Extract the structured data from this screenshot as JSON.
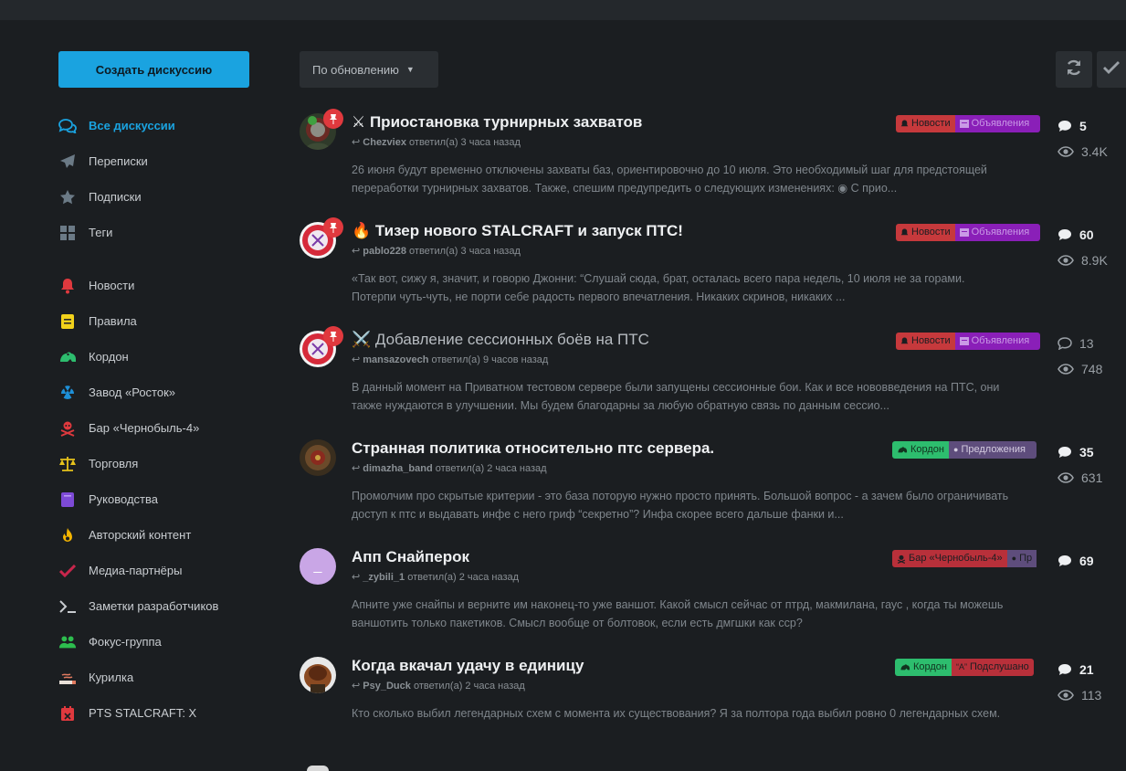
{
  "sidebar": {
    "create_label": "Создать дискуссию",
    "items": [
      {
        "label": "Все дискуссии",
        "icon": "comments-icon"
      },
      {
        "label": "Переписки",
        "icon": "paper-plane-icon"
      },
      {
        "label": "Подписки",
        "icon": "star-icon"
      },
      {
        "label": "Теги",
        "icon": "th-large-icon"
      },
      {
        "label": "Новости",
        "icon": "bell-icon"
      },
      {
        "label": "Правила",
        "icon": "rules-book-icon"
      },
      {
        "label": "Кордон",
        "icon": "frog-icon"
      },
      {
        "label": "Завод «Росток»",
        "icon": "radiation-icon"
      },
      {
        "label": "Бар «Чернобыль-4»",
        "icon": "skull-crossbones-icon"
      },
      {
        "label": "Торговля",
        "icon": "balance-scale-icon"
      },
      {
        "label": "Руководства",
        "icon": "book-icon"
      },
      {
        "label": "Авторский контент",
        "icon": "fire-icon"
      },
      {
        "label": "Медиа-партнёры",
        "icon": "check-icon"
      },
      {
        "label": "Заметки разработчиков",
        "icon": "terminal-icon"
      },
      {
        "label": "Фокус-группа",
        "icon": "users-icon"
      },
      {
        "label": "Курилка",
        "icon": "smoking-icon"
      },
      {
        "label": "PTS STALCRAFT: X",
        "icon": "calendar-x-icon"
      }
    ]
  },
  "toolbar": {
    "sort_label": "По обновлению",
    "refresh_icon": "refresh-icon",
    "mark_read_icon": "check-icon"
  },
  "discussions": [
    {
      "title": "⚔ Приостановка турнирных захватов",
      "author": "Chezviex",
      "action": "ответил(а) 3 часа назад",
      "excerpt": "26 июня будут временно отключены захваты баз, ориентировочно до 10 июля. Это необходимый шаг для предстоящей переработки турнирных захватов. Также, спешим предупредить о следующих изменениях: ◉ С прио...",
      "tags": [
        "Новости",
        "Объявления"
      ],
      "replies": "5",
      "views": "3.4K"
    },
    {
      "title": "🔥 Тизер нового STALCRAFT и запуск ПТС!",
      "author": "pablo228",
      "action": "ответил(а) 3 часа назад",
      "excerpt": "«Так вот, сижу я, значит, и говорю Джонни: “Слушай сюда, брат, осталась всего пара недель, 10 июля не за горами. Потерпи чуть-чуть, не порти себе радость первого впечатления. Никаких скринов, никаких ...",
      "tags": [
        "Новости",
        "Объявления"
      ],
      "replies": "60",
      "views": "8.9K"
    },
    {
      "title": "⚔️ Добавление сессионных боёв на ПТС",
      "author": "mansazovech",
      "action": "ответил(а) 9 часов назад",
      "excerpt": "В данный момент на Приватном тестовом сервере были запущены сессионные бои. Как и все нововведения на ПТС, они также нуждаются в улучшении. Мы будем благодарны за любую обратную связь по данным сессио...",
      "tags": [
        "Новости",
        "Объявления"
      ],
      "replies": "13",
      "views": "748"
    },
    {
      "title": "Странная политика относительно птс сервера.",
      "author": "dimazha_band",
      "action": "ответил(а) 2 часа назад",
      "excerpt": "Промолчим про скрытые критерии - это база поторую нужно просто принять. Большой вопрос - а зачем было ограничивать доступ к птс и выдавать инфе с него гриф “секретно”? Инфа скорее всего дальше фанки и...",
      "tags": [
        "Кордон",
        "Предложения"
      ],
      "replies": "35",
      "views": "631"
    },
    {
      "title": "Апп Снайперок",
      "author": "_zybili_1",
      "action": "ответил(а) 2 часа назад",
      "avatar_letter": "_",
      "excerpt": "Апните уже снайпы и верните им наконец-то уже ваншот. Какой смысл сейчас от птрд, макмилана, гаус , когда ты можешь ваншотить только пакетиков. Смысл вообще от болтовок, если есть дмгшки как сср?",
      "tags": [
        "Бар «Чернобыль-4»",
        "Пр"
      ],
      "replies": "69",
      "views": ""
    },
    {
      "title": "Когда вкачал удачу в единицу",
      "author": "Psy_Duck",
      "action": "ответил(а) 2 часа назад",
      "excerpt": "Кто сколько выбил легендарных схем с момента их существования? Я за полтора года выбил ровно 0 легендарных схем.",
      "tags": [
        "Кордон",
        "Подслушано"
      ],
      "replies": "21",
      "views": "113"
    }
  ],
  "colors": {
    "accent": "#1aa3e0",
    "news": "#c6393c",
    "announce": "#8a1fb8",
    "kordon": "#2dbd6e",
    "proposals": "#5e4d7c",
    "bar": "#b8303a",
    "overheard": "#b8303a",
    "pin": "#e0393e"
  }
}
